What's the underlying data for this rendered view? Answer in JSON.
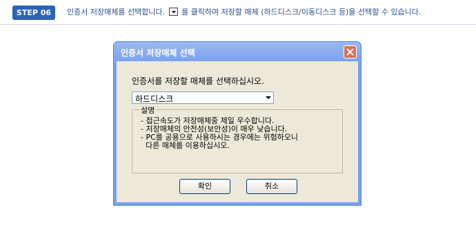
{
  "step": {
    "badge": "STEP 06",
    "text_before": "인증서 저장매체를 선택합니다.",
    "text_after": "를 클릭하여 저장할 매체 (하드디스크/이동디스크 등)을 선택할 수 있습니다."
  },
  "dialog": {
    "title": "인증서 저장매체 선택",
    "instruction": "인증서를 저장할 매체를 선택하십시오.",
    "select_value": "하드디스크",
    "legend": "설명",
    "description": [
      "- 접근속도가 저장매체중 제일 우수합니다.",
      "- 저장매체의 안전성(보안성)이 매우 낮습니다.",
      "- PC를 공용으로 사용하시는 경우에는 위험하오니",
      "  다른 매체를 이용하십시오."
    ],
    "ok_label": "확인",
    "cancel_label": "취소"
  }
}
